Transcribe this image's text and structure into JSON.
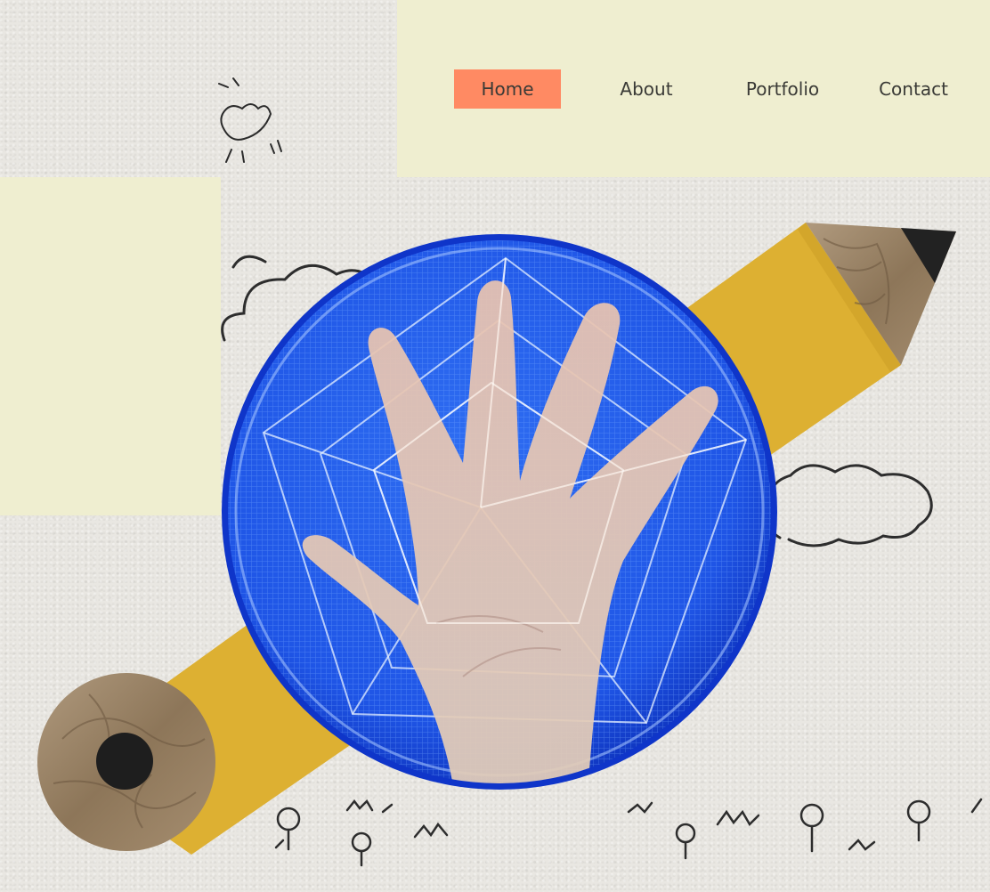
{
  "nav": {
    "items": [
      {
        "label": "Home",
        "active": true
      },
      {
        "label": "About",
        "active": false
      },
      {
        "label": "Portfolio",
        "active": false
      },
      {
        "label": "Contact",
        "active": false
      }
    ]
  },
  "colors": {
    "panel": "#efeed0",
    "active_nav": "#ff8a63",
    "pencil_body": "#ddb032",
    "circle_blue": "#1749e0"
  }
}
